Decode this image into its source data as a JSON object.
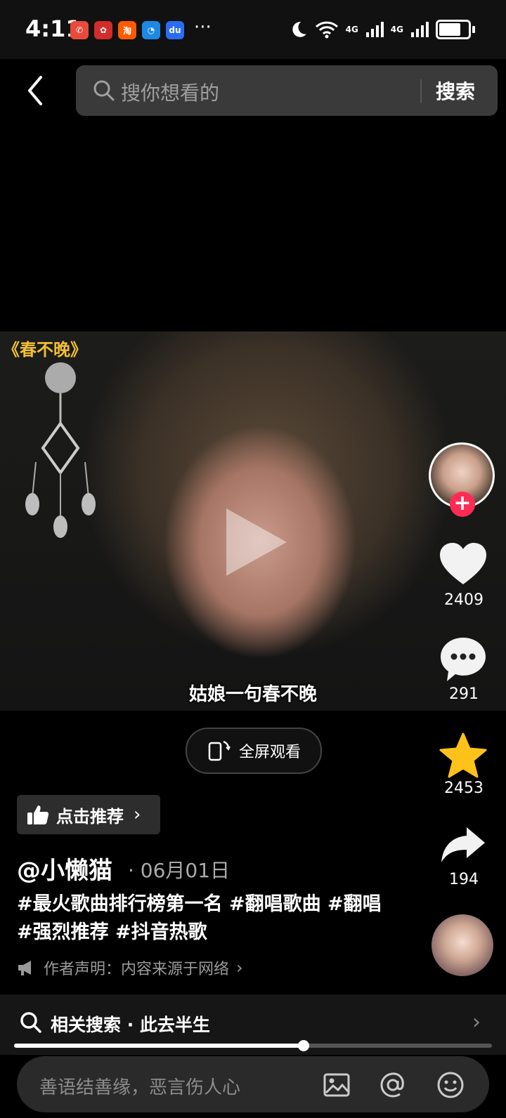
{
  "status_bar": {
    "time": "4:11",
    "more": "···",
    "signal1": "4G",
    "signal2": "4G"
  },
  "search": {
    "placeholder": "搜你想看的",
    "button": "搜索"
  },
  "video": {
    "song_title": "《春不晚》",
    "subtitle": "姑娘一句春不晚"
  },
  "actions": {
    "likes": "2409",
    "comments": "291",
    "favorites": "2453",
    "shares": "194"
  },
  "fullscreen_label": "全屏观看",
  "recommend_label": "点击推荐",
  "post": {
    "username": "@小懒猫",
    "date": "· 06月01日",
    "tags": "#最火歌曲排行榜第一名 #翻唱歌曲 #翻唱 #强烈推荐 #抖音热歌",
    "declaration": "作者声明：内容来源于网络"
  },
  "related_search": "相关搜索 · 此去半生",
  "progress": 0.606,
  "comment_placeholder": "善语结善缘，恶言伤人心",
  "colors": {
    "accent": "#fe2c55",
    "star": "#ffc21a",
    "background": "#000000"
  }
}
